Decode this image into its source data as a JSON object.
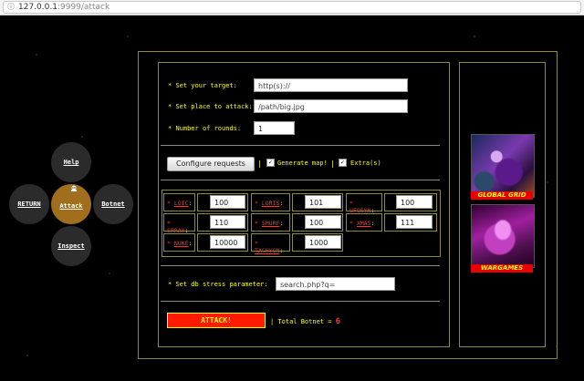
{
  "browser": {
    "url_host": "127.0.0.1",
    "url_rest": ":9999/attack"
  },
  "menu": {
    "help": "Help",
    "return": "RETURN",
    "attack": "Attack",
    "botnet": "Botnet",
    "inspect": "Inspect"
  },
  "form": {
    "target_label": "Set your target:",
    "target_placeholder": "http(s)://",
    "place_label": "Set place to attack:",
    "place_placeholder": "/path/big.jpg",
    "rounds_label": "Number of rounds:",
    "rounds_value": "1",
    "configure_label": "Configure requests",
    "sep": "|",
    "generate_map_label": "Generate map!",
    "extra_label": "Extra(s)",
    "db_label": "Set db stress parameter:",
    "db_placeholder": "search.php?q=",
    "attack_label": "ATTACK!",
    "total_botnet_label": "| Total Botnet =",
    "total_botnet_count": "6"
  },
  "params": [
    {
      "key": "LOIC",
      "value": "100"
    },
    {
      "key": "LORIS",
      "value": "101"
    },
    {
      "key": "UFOSYN",
      "value": "100"
    },
    {
      "key": "SPRAY",
      "value": "110"
    },
    {
      "key": "SMURF",
      "value": "100"
    },
    {
      "key": "XMAS",
      "value": "111"
    },
    {
      "key": "NUKE",
      "value": "10000"
    },
    {
      "key": "TACHYON",
      "value": "1000"
    }
  ],
  "side": {
    "caption1": "GLOBAL GRID",
    "caption2": "WARGAMES"
  },
  "colors": {
    "accent": "#ffff00",
    "alert": "#ff1a00",
    "active_orb": "#a06e1c"
  }
}
